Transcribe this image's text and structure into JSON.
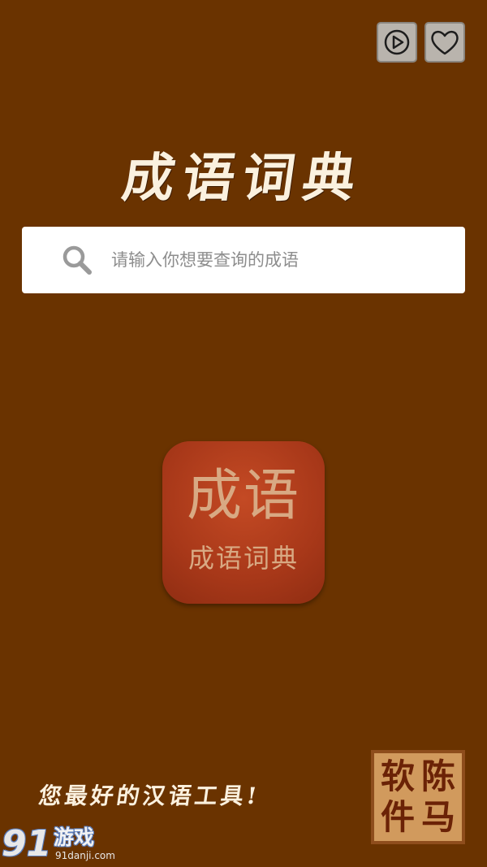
{
  "header": {
    "play_icon": "play-circle-icon",
    "favorite_icon": "heart-icon"
  },
  "title": "成语词典",
  "search": {
    "icon": "search-icon",
    "value": "",
    "placeholder": "请输入你想要查询的成语"
  },
  "app_icon": {
    "big_text": "成语",
    "small_text": "成语词典"
  },
  "footer": {
    "slogan": "您最好的汉语工具!",
    "seal_chars": [
      "软",
      "陈",
      "件",
      "马"
    ]
  },
  "watermark": {
    "number": "91",
    "name": "游戏",
    "site": "91danji.com"
  },
  "colors": {
    "background": "#6a3300",
    "title_text": "#fbf1df",
    "search_background": "#ffffff",
    "placeholder_text": "#8d8d8d",
    "icon_button": "#b9b4ad",
    "app_icon_red": "#a83819",
    "seal": "#d19a5d"
  }
}
